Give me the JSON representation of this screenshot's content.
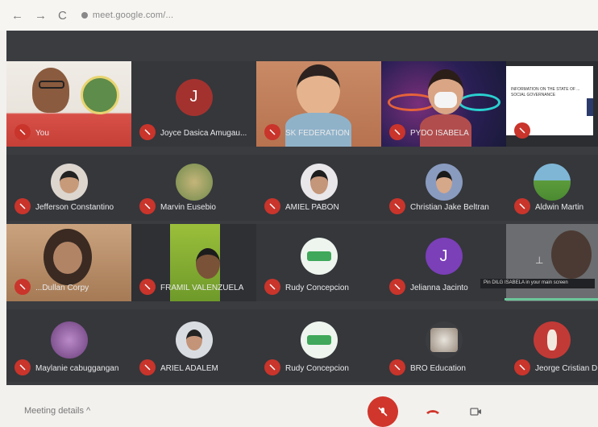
{
  "browser": {
    "back": "←",
    "forward": "→",
    "reload": "C",
    "url": "meet.google.com/..."
  },
  "tiles": [
    {
      "name": "You"
    },
    {
      "name": "Joyce Dasica Amugau..."
    },
    {
      "name": "SK FEDERATION"
    },
    {
      "name": "PYDO ISABELA"
    },
    {
      "name": ""
    },
    {
      "name": "Jefferson Constantino"
    },
    {
      "name": "Marvin Eusebio"
    },
    {
      "name": "AMIEL PABON"
    },
    {
      "name": "Christian Jake Beltran"
    },
    {
      "name": "Aldwin Martin"
    },
    {
      "name": "...Dullan Corpy"
    },
    {
      "name": "FRAMIL VALENZUELA"
    },
    {
      "name": "Rudy Concepcion"
    },
    {
      "name": "Jelianna Jacinto"
    },
    {
      "name": ""
    },
    {
      "name": "Maylanie cabuggangan"
    },
    {
      "name": "ARIEL ADALEM"
    },
    {
      "name": "Rudy Concepcion"
    },
    {
      "name": "BRO Education"
    },
    {
      "name": "Jeorge Cristian D..."
    }
  ],
  "avatar_letters": {
    "joyce": "J",
    "jelianna": "J"
  },
  "presentation": {
    "title": "INFORMATION ON THE STATE OF ... SOCIAL GOVERNANCE"
  },
  "tooltip": "Pin DILG ISABELA in your main screen",
  "bottom": {
    "details": "Meeting details  ^"
  },
  "colors": {
    "mic_muted": "#c9342b",
    "stage": "#3a3c40",
    "hangup": "#d0362c"
  }
}
